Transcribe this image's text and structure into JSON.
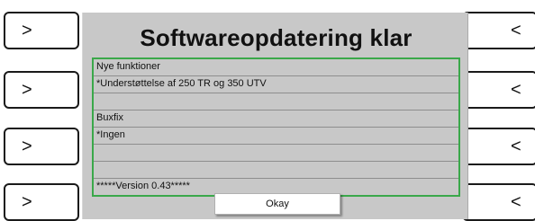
{
  "side_buttons": {
    "left_icon": "chevron-right-icon",
    "right_icon": "chevron-left-icon",
    "left_glyph": ">",
    "right_glyph": "<"
  },
  "dialog": {
    "title": "Softwareopdatering klar",
    "rows": [
      "Nye funktioner",
      "*Understøttelse af 250 TR og 350 UTV",
      "",
      "Buxfix",
      "*Ingen",
      "",
      "",
      "*****Version 0.43*****"
    ],
    "okay_label": "Okay"
  },
  "colors": {
    "panel_bg": "#c8c8c8",
    "list_border": "#3aa84a"
  }
}
